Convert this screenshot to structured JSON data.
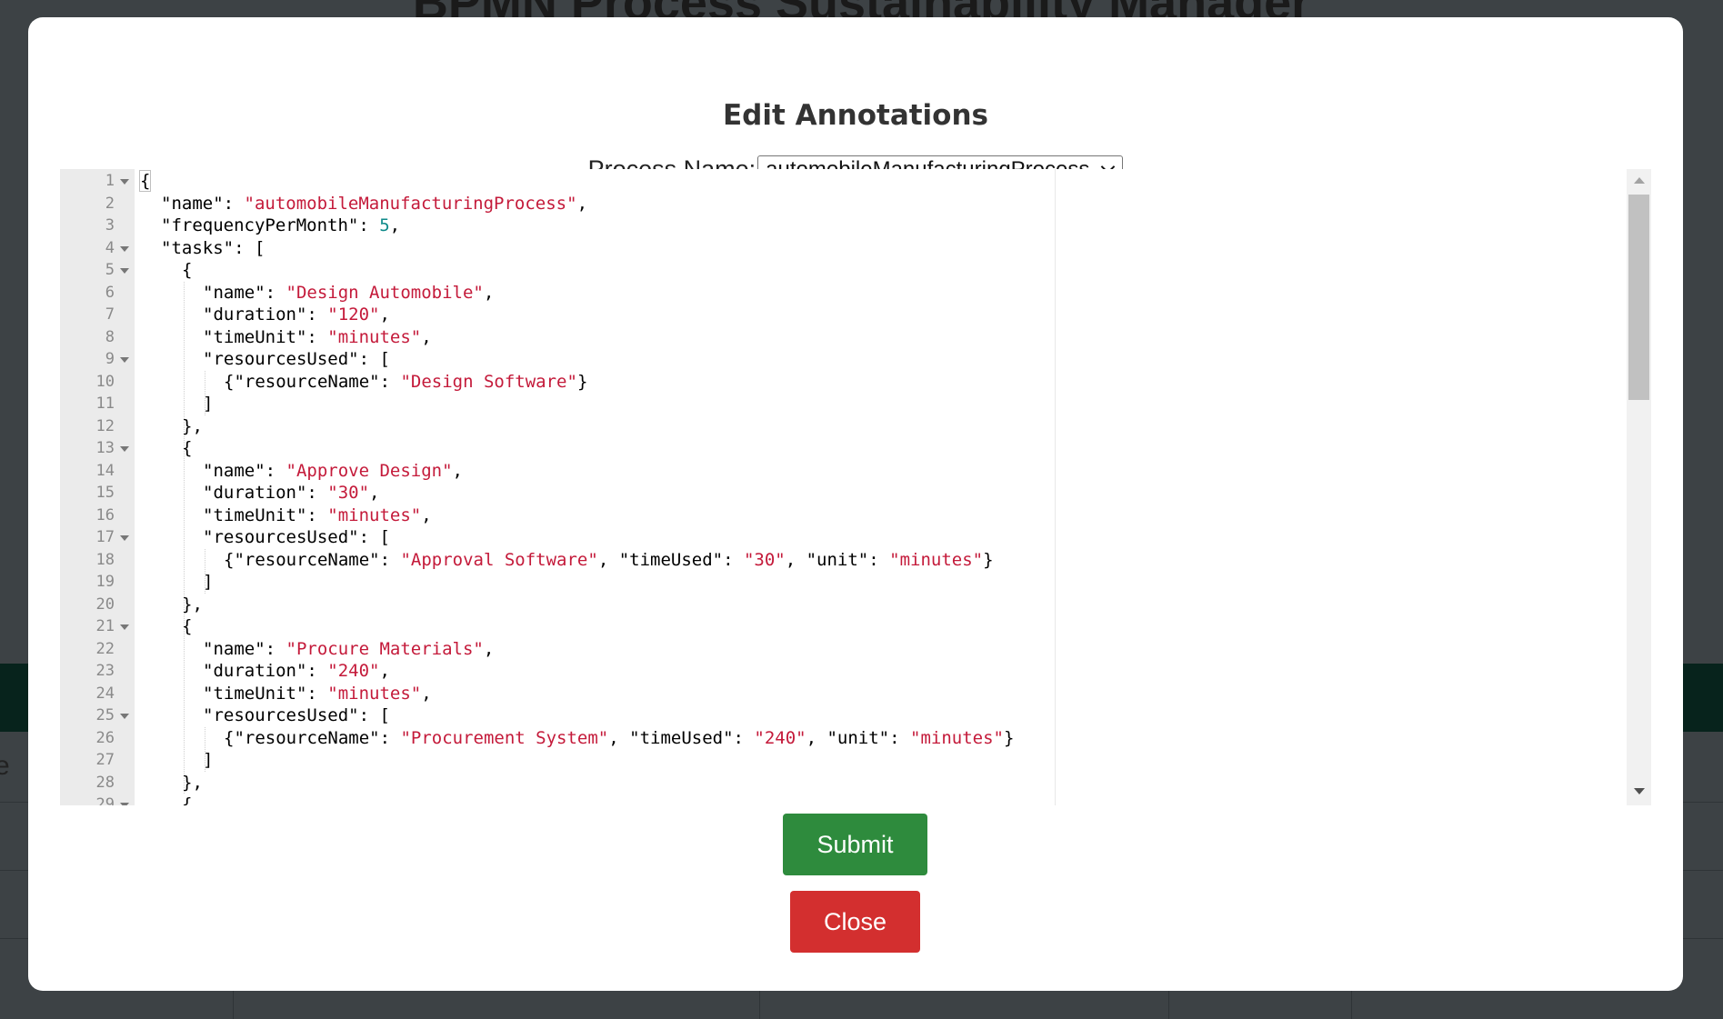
{
  "background": {
    "app_title": "BPMN Process Sustainability Manager",
    "partial_text": "e"
  },
  "modal": {
    "title": "Edit Annotations",
    "process_label": "Process Name:",
    "process_selected": "automobileManufacturingProcess",
    "submit_label": "Submit",
    "close_label": "Close"
  },
  "editor": {
    "lines": [
      {
        "n": "1",
        "fold": true,
        "indent": 0,
        "tokens": [
          [
            "k",
            "{"
          ]
        ]
      },
      {
        "n": "2",
        "fold": false,
        "indent": 1,
        "tokens": [
          [
            "k",
            "\"name\": "
          ],
          [
            "s",
            "\"automobileManufacturingProcess\""
          ],
          [
            "k",
            ","
          ]
        ]
      },
      {
        "n": "3",
        "fold": false,
        "indent": 1,
        "tokens": [
          [
            "k",
            "\"frequencyPerMonth\": "
          ],
          [
            "n",
            "5"
          ],
          [
            "k",
            ","
          ]
        ]
      },
      {
        "n": "4",
        "fold": true,
        "indent": 1,
        "tokens": [
          [
            "k",
            "\"tasks\": ["
          ]
        ]
      },
      {
        "n": "5",
        "fold": true,
        "indent": 2,
        "tokens": [
          [
            "k",
            "{"
          ]
        ]
      },
      {
        "n": "6",
        "fold": false,
        "indent": 3,
        "tokens": [
          [
            "k",
            "\"name\": "
          ],
          [
            "s",
            "\"Design Automobile\""
          ],
          [
            "k",
            ","
          ]
        ]
      },
      {
        "n": "7",
        "fold": false,
        "indent": 3,
        "tokens": [
          [
            "k",
            "\"duration\": "
          ],
          [
            "s",
            "\"120\""
          ],
          [
            "k",
            ","
          ]
        ]
      },
      {
        "n": "8",
        "fold": false,
        "indent": 3,
        "tokens": [
          [
            "k",
            "\"timeUnit\": "
          ],
          [
            "s",
            "\"minutes\""
          ],
          [
            "k",
            ","
          ]
        ]
      },
      {
        "n": "9",
        "fold": true,
        "indent": 3,
        "tokens": [
          [
            "k",
            "\"resourcesUsed\": ["
          ]
        ]
      },
      {
        "n": "10",
        "fold": false,
        "indent": 4,
        "tokens": [
          [
            "k",
            "{\"resourceName\": "
          ],
          [
            "s",
            "\"Design Software\""
          ],
          [
            "k",
            "}"
          ]
        ]
      },
      {
        "n": "11",
        "fold": false,
        "indent": 3,
        "tokens": [
          [
            "k",
            "]"
          ]
        ]
      },
      {
        "n": "12",
        "fold": false,
        "indent": 2,
        "tokens": [
          [
            "k",
            "},"
          ]
        ]
      },
      {
        "n": "13",
        "fold": true,
        "indent": 2,
        "tokens": [
          [
            "k",
            "{"
          ]
        ]
      },
      {
        "n": "14",
        "fold": false,
        "indent": 3,
        "tokens": [
          [
            "k",
            "\"name\": "
          ],
          [
            "s",
            "\"Approve Design\""
          ],
          [
            "k",
            ","
          ]
        ]
      },
      {
        "n": "15",
        "fold": false,
        "indent": 3,
        "tokens": [
          [
            "k",
            "\"duration\": "
          ],
          [
            "s",
            "\"30\""
          ],
          [
            "k",
            ","
          ]
        ]
      },
      {
        "n": "16",
        "fold": false,
        "indent": 3,
        "tokens": [
          [
            "k",
            "\"timeUnit\": "
          ],
          [
            "s",
            "\"minutes\""
          ],
          [
            "k",
            ","
          ]
        ]
      },
      {
        "n": "17",
        "fold": true,
        "indent": 3,
        "tokens": [
          [
            "k",
            "\"resourcesUsed\": ["
          ]
        ]
      },
      {
        "n": "18",
        "fold": false,
        "indent": 4,
        "tokens": [
          [
            "k",
            "{\"resourceName\": "
          ],
          [
            "s",
            "\"Approval Software\""
          ],
          [
            "k",
            ", \"timeUsed\": "
          ],
          [
            "s",
            "\"30\""
          ],
          [
            "k",
            ", \"unit\": "
          ],
          [
            "s",
            "\"minutes\""
          ],
          [
            "k",
            "}"
          ]
        ]
      },
      {
        "n": "19",
        "fold": false,
        "indent": 3,
        "tokens": [
          [
            "k",
            "]"
          ]
        ]
      },
      {
        "n": "20",
        "fold": false,
        "indent": 2,
        "tokens": [
          [
            "k",
            "},"
          ]
        ]
      },
      {
        "n": "21",
        "fold": true,
        "indent": 2,
        "tokens": [
          [
            "k",
            "{"
          ]
        ]
      },
      {
        "n": "22",
        "fold": false,
        "indent": 3,
        "tokens": [
          [
            "k",
            "\"name\": "
          ],
          [
            "s",
            "\"Procure Materials\""
          ],
          [
            "k",
            ","
          ]
        ]
      },
      {
        "n": "23",
        "fold": false,
        "indent": 3,
        "tokens": [
          [
            "k",
            "\"duration\": "
          ],
          [
            "s",
            "\"240\""
          ],
          [
            "k",
            ","
          ]
        ]
      },
      {
        "n": "24",
        "fold": false,
        "indent": 3,
        "tokens": [
          [
            "k",
            "\"timeUnit\": "
          ],
          [
            "s",
            "\"minutes\""
          ],
          [
            "k",
            ","
          ]
        ]
      },
      {
        "n": "25",
        "fold": true,
        "indent": 3,
        "tokens": [
          [
            "k",
            "\"resourcesUsed\": ["
          ]
        ]
      },
      {
        "n": "26",
        "fold": false,
        "indent": 4,
        "tokens": [
          [
            "k",
            "{\"resourceName\": "
          ],
          [
            "s",
            "\"Procurement System\""
          ],
          [
            "k",
            ", \"timeUsed\": "
          ],
          [
            "s",
            "\"240\""
          ],
          [
            "k",
            ", \"unit\": "
          ],
          [
            "s",
            "\"minutes\""
          ],
          [
            "k",
            "}"
          ]
        ]
      },
      {
        "n": "27",
        "fold": false,
        "indent": 3,
        "tokens": [
          [
            "k",
            "]"
          ]
        ]
      },
      {
        "n": "28",
        "fold": false,
        "indent": 2,
        "tokens": [
          [
            "k",
            "},"
          ]
        ]
      },
      {
        "n": "29",
        "fold": true,
        "indent": 2,
        "tokens": [
          [
            "k",
            "{"
          ]
        ]
      }
    ]
  },
  "icons": {
    "dropdown": "chevron-down-icon",
    "fold": "fold-arrow-icon",
    "scroll_up": "scroll-up-arrow-icon",
    "scroll_down": "scroll-down-arrow-icon"
  },
  "colors": {
    "submit": "#2e8b3d",
    "close": "#d32f2f",
    "string": "#c41a3a",
    "number": "#0f8a8a"
  }
}
